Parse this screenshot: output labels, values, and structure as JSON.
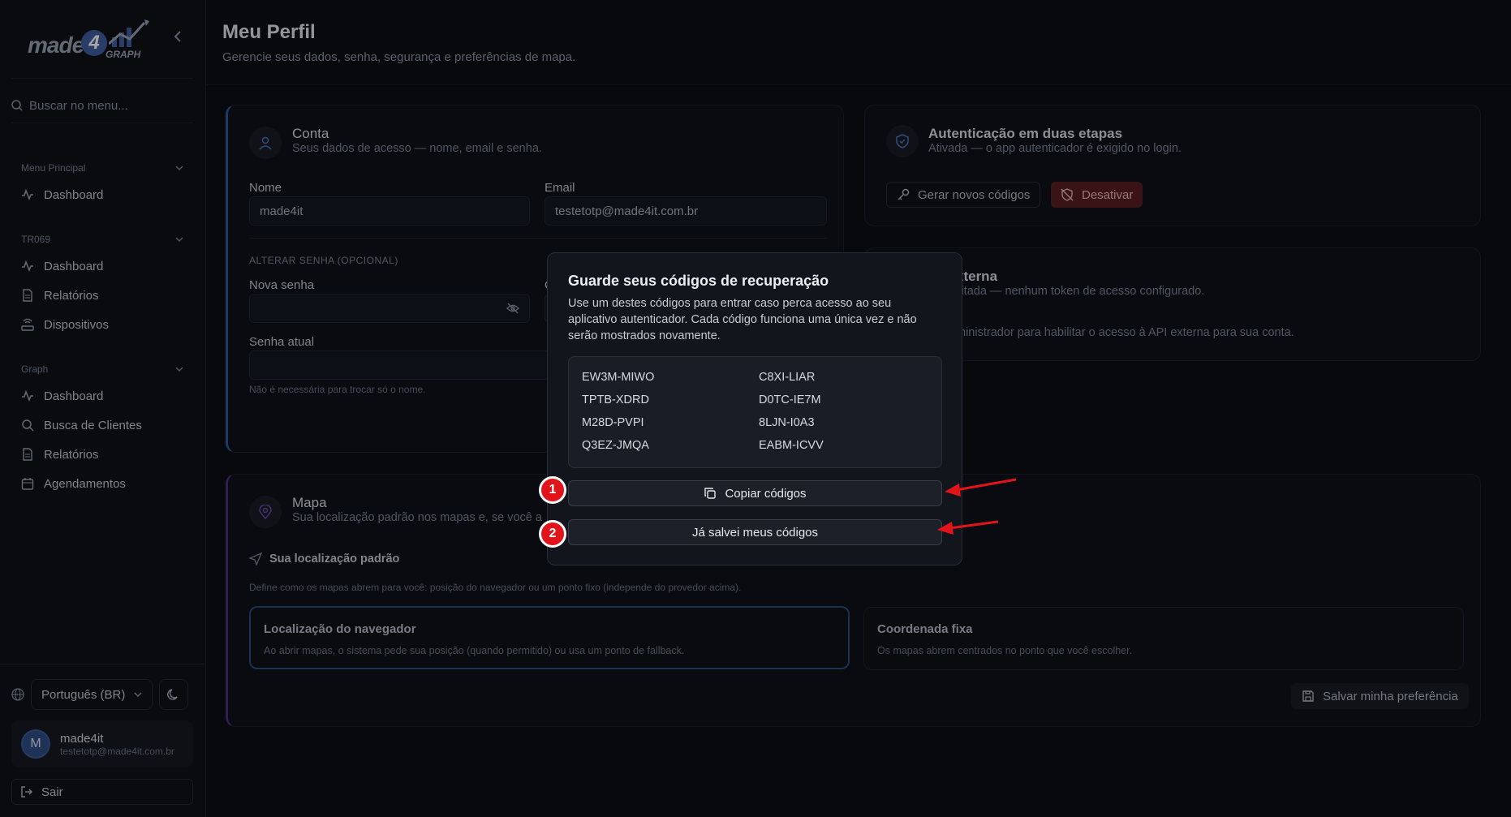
{
  "sidebar": {
    "logo": {
      "text": "made",
      "four": "4",
      "sub": "GRAPH"
    },
    "search_placeholder": "Buscar no menu...",
    "groups": [
      {
        "title": "Menu Principal",
        "items": [
          {
            "label": "Dashboard",
            "icon": "activity-icon"
          }
        ]
      },
      {
        "title": "TR069",
        "items": [
          {
            "label": "Dashboard",
            "icon": "activity-icon"
          },
          {
            "label": "Relatórios",
            "icon": "file-icon"
          },
          {
            "label": "Dispositivos",
            "icon": "router-icon"
          }
        ]
      },
      {
        "title": "Graph",
        "items": [
          {
            "label": "Dashboard",
            "icon": "activity-icon"
          },
          {
            "label": "Busca de Clientes",
            "icon": "search-icon"
          },
          {
            "label": "Relatórios",
            "icon": "file-icon"
          },
          {
            "label": "Agendamentos",
            "icon": "calendar-icon"
          }
        ]
      }
    ],
    "language": "Português (BR)",
    "user": {
      "initial": "M",
      "name": "made4it",
      "email": "testetotp@made4it.com.br"
    },
    "logout_label": "Sair"
  },
  "header": {
    "title": "Meu Perfil",
    "subtitle": "Gerencie seus dados, senha, segurança e preferências de mapa."
  },
  "account_card": {
    "title": "Conta",
    "subtitle": "Seus dados de acesso — nome, email e senha.",
    "name_label": "Nome",
    "name_value": "made4it",
    "email_label": "Email",
    "email_value": "testetotp@made4it.com.br",
    "password_section": "ALTERAR SENHA (OPCIONAL)",
    "new_password_label": "Nova senha",
    "confirm_label_partial": "C",
    "current_password_label": "Senha atual",
    "current_password_note": "Não é necessária para trocar só o nome."
  },
  "twofa_card": {
    "title": "Autenticação em duas etapas",
    "subtitle": "Ativada — o app autenticador é exigido no login.",
    "regen_label": "Gerar novos códigos",
    "disable_label": "Desativar"
  },
  "api_card": {
    "title_partial": "xterna",
    "subtitle_partial": "ilitada — nenhum token de acesso configurado.",
    "note_partial": "ministrador para habilitar o acesso à API externa para sua conta."
  },
  "map_card": {
    "title": "Mapa",
    "subtitle_partial": "Sua localização padrão nos mapas e, se você a",
    "section_title": "Sua localização padrão",
    "section_desc": "Define como os mapas abrem para você: posição do navegador ou um ponto fixo (independe do provedor acima).",
    "options": [
      {
        "title": "Localização do navegador",
        "desc": "Ao abrir mapas, o sistema pede sua posição (quando permitido) ou usa um ponto de fallback.",
        "selected": true
      },
      {
        "title": "Coordenada fixa",
        "desc": "Os mapas abrem centrados no ponto que você escolher.",
        "selected": false
      }
    ],
    "save_label": "Salvar minha preferência"
  },
  "modal": {
    "title": "Guarde seus códigos de recuperação",
    "description": "Use um destes códigos para entrar caso perca acesso ao seu aplicativo autenticador. Cada código funciona uma única vez e não serão mostrados novamente.",
    "codes": [
      "EW3M-MIWO",
      "C8XI-LIAR",
      "TPTB-XDRD",
      "D0TC-IE7M",
      "M28D-PVPI",
      "8LJN-I0A3",
      "Q3EZ-JMQA",
      "EABM-ICVV"
    ],
    "copy_label": "Copiar códigos",
    "saved_label": "Já salvei meus códigos"
  },
  "annotations": {
    "badge1": "1",
    "badge2": "2",
    "color": "#e0141a"
  }
}
